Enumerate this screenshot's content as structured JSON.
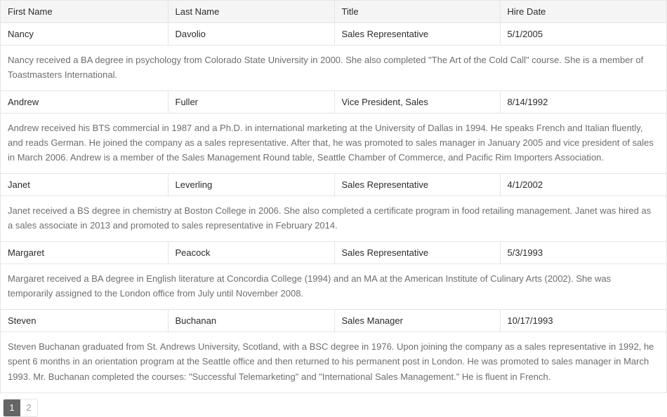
{
  "grid": {
    "columns": [
      {
        "key": "first_name",
        "label": "First Name"
      },
      {
        "key": "last_name",
        "label": "Last Name"
      },
      {
        "key": "title",
        "label": "Title"
      },
      {
        "key": "hire_date",
        "label": "Hire Date"
      }
    ],
    "rows": [
      {
        "first_name": "Nancy",
        "last_name": "Davolio",
        "title": "Sales Representative",
        "hire_date": "5/1/2005",
        "notes": "Nancy received a BA degree in psychology from Colorado State University in 2000. She also completed \"The Art of the Cold Call\" course. She is a member of Toastmasters International."
      },
      {
        "first_name": "Andrew",
        "last_name": "Fuller",
        "title": "Vice President, Sales",
        "hire_date": "8/14/1992",
        "notes": "Andrew received his BTS commercial in 1987 and a Ph.D. in international marketing at the University of Dallas in 1994. He speaks French and Italian fluently, and reads German. He joined the company as a sales representative. After that, he was promoted to sales manager in January 2005 and vice president of sales in March 2006. Andrew is a member of the Sales Management Round table, Seattle Chamber of Commerce, and Pacific Rim Importers Association."
      },
      {
        "first_name": "Janet",
        "last_name": "Leverling",
        "title": "Sales Representative",
        "hire_date": "4/1/2002",
        "notes": "Janet received a BS degree in chemistry at Boston College in 2006. She also completed a certificate program in food retailing management. Janet was hired as a sales associate in 2013 and promoted to sales representative in February 2014."
      },
      {
        "first_name": "Margaret",
        "last_name": "Peacock",
        "title": "Sales Representative",
        "hire_date": "5/3/1993",
        "notes": "Margaret received a BA degree in English literature at Concordia College (1994) and an MA at the American Institute of Culinary Arts (2002). She was temporarily assigned to the London office from July until November 2008."
      },
      {
        "first_name": "Steven",
        "last_name": "Buchanan",
        "title": "Sales Manager",
        "hire_date": "10/17/1993",
        "notes": "Steven Buchanan graduated from St. Andrews University, Scotland, with a BSC degree in 1976. Upon joining the company as a sales representative in 1992, he spent 6 months in an orientation program at the Seattle office and then returned to his permanent post in London. He was promoted to sales manager in March 1993. Mr. Buchanan completed the courses: \"Successful Telemarketing\" and \"International Sales Management.\" He is fluent in French."
      }
    ]
  },
  "pager": {
    "pages": [
      {
        "label": "1",
        "active": true
      },
      {
        "label": "2",
        "active": false
      }
    ]
  },
  "colors": {
    "header_bg": "#f5f5f5",
    "border": "#e5e5e5",
    "text": "#2b2b2b",
    "detail_text": "#6e6e6e",
    "pager_active_bg": "#656565"
  }
}
